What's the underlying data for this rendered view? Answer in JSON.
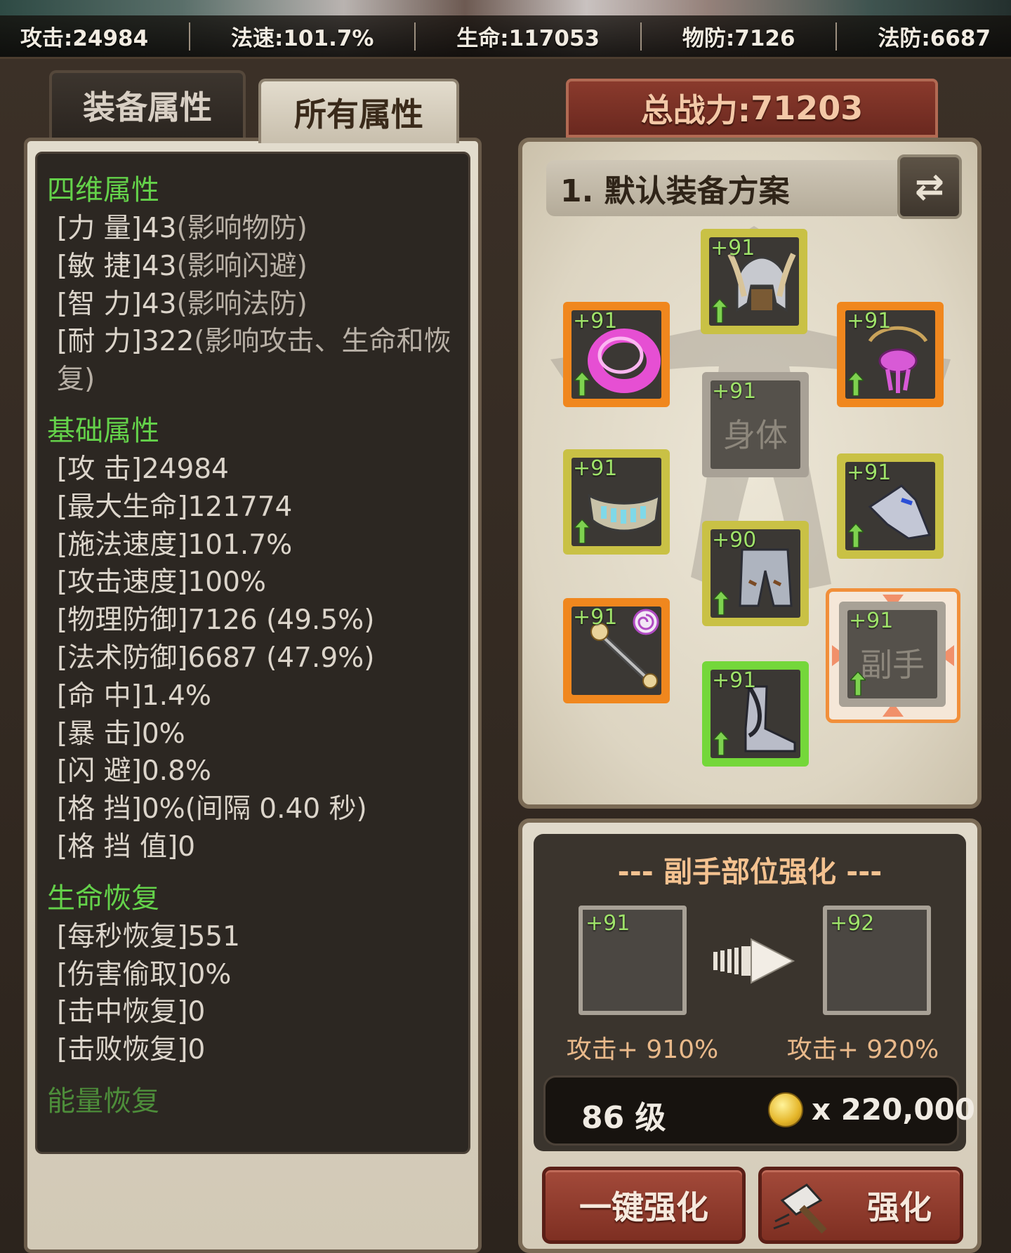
{
  "top_stats": {
    "attack": "攻击:24984",
    "cast_speed": "法速:101.7%",
    "hp": "生命:117053",
    "phys_def": "物防:7126",
    "magic_def": "法防:6687"
  },
  "tabs": {
    "equip_attrs": "装备属性",
    "all_attrs": "所有属性"
  },
  "sections": {
    "four_dim": {
      "title": "四维属性",
      "items": [
        {
          "label": "[力  量]",
          "value": "43",
          "note": "(影响物防)"
        },
        {
          "label": "[敏  捷]",
          "value": "43",
          "note": "(影响闪避)"
        },
        {
          "label": "[智  力]",
          "value": "43",
          "note": "(影响法防)"
        },
        {
          "label": "[耐  力]",
          "value": "322",
          "note": "(影响攻击、生命和恢复)"
        }
      ]
    },
    "basic": {
      "title": "基础属性",
      "items": [
        {
          "label": "[攻      击]",
          "value": "24984"
        },
        {
          "label": "[最大生命]",
          "value": "121774"
        },
        {
          "label": "[施法速度]",
          "value": "101.7%"
        },
        {
          "label": "[攻击速度]",
          "value": "100%"
        },
        {
          "label": "[物理防御]",
          "value": "7126 (49.5%)"
        },
        {
          "label": "[法术防御]",
          "value": "6687 (47.9%)"
        },
        {
          "label": "[命      中]",
          "value": "1.4%"
        },
        {
          "label": "[暴      击]",
          "value": "0%"
        },
        {
          "label": "[闪      避]",
          "value": "0.8%"
        },
        {
          "label": "[格      挡]",
          "value": "0%(间隔 0.40 秒)"
        },
        {
          "label": "[格  挡  值]",
          "value": "0"
        }
      ]
    },
    "regen": {
      "title": "生命恢复",
      "items": [
        {
          "label": "[每秒恢复]",
          "value": "551"
        },
        {
          "label": "[伤害偷取]",
          "value": "0%"
        },
        {
          "label": "[击中恢复]",
          "value": "0"
        },
        {
          "label": "[击败恢复]",
          "value": "0"
        }
      ]
    },
    "next_peek": "能量恢复"
  },
  "power": {
    "label": "总战力:",
    "value": "71203"
  },
  "plan": {
    "name": "1. 默认装备方案"
  },
  "slots": {
    "helmet": {
      "level": "+91",
      "icon": "helmet-icon",
      "rarity": "gold"
    },
    "ring": {
      "level": "+91",
      "icon": "ring-icon",
      "rarity": "orange"
    },
    "necklace": {
      "level": "+91",
      "icon": "necklace-icon",
      "rarity": "orange"
    },
    "body": {
      "level": "+91",
      "label": "身体",
      "rarity": "empty"
    },
    "belt": {
      "level": "+91",
      "icon": "belt-icon",
      "rarity": "gold"
    },
    "gloves": {
      "level": "+91",
      "icon": "gloves-icon",
      "rarity": "gold"
    },
    "pants": {
      "level": "+90",
      "icon": "pants-icon",
      "rarity": "gold"
    },
    "weapon": {
      "level": "+91",
      "icon": "staff-icon",
      "rarity": "orange"
    },
    "boots": {
      "level": "+91",
      "icon": "boots-icon",
      "rarity": "green"
    },
    "offhand": {
      "level": "+91",
      "label": "副手",
      "rarity": "empty"
    }
  },
  "enhance": {
    "title": "--- 副手部位强化 ---",
    "from_level": "+91",
    "to_level": "+92",
    "from_bonus": "攻击+ 910%",
    "to_bonus": "攻击+ 920%",
    "level_req": "86 级",
    "cost": "x 220,000",
    "one_key_label": "一键强化",
    "enhance_label": "强化"
  },
  "colors": {
    "green_title": "#64d24a",
    "power_banner": "#7a3126",
    "gold_frame": "#c9c145",
    "orange_frame": "#f0871e",
    "green_frame": "#74d73a"
  }
}
